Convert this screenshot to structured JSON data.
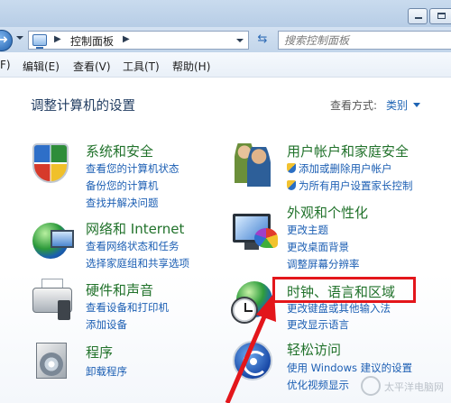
{
  "address_bar": {
    "crumb": "控制面板",
    "search_placeholder": "搜索控制面板"
  },
  "menu": {
    "items": [
      "F)",
      "编辑(E)",
      "查看(V)",
      "工具(T)",
      "帮助(H)"
    ]
  },
  "page": {
    "title": "调整计算机的设置",
    "view_by_label": "查看方式:",
    "view_by_value": "类别"
  },
  "categories": {
    "system_security": {
      "title": "系统和安全",
      "links": [
        "查看您的计算机状态",
        "备份您的计算机",
        "查找并解决问题"
      ]
    },
    "network_internet": {
      "title": "网络和 Internet",
      "links": [
        "查看网络状态和任务",
        "选择家庭组和共享选项"
      ]
    },
    "hardware_sound": {
      "title": "硬件和声音",
      "links": [
        "查看设备和打印机",
        "添加设备"
      ]
    },
    "programs": {
      "title": "程序",
      "links": [
        "卸载程序"
      ]
    },
    "user_accounts": {
      "title": "用户帐户和家庭安全",
      "links": [
        "添加或删除用户帐户",
        "为所有用户设置家长控制"
      ]
    },
    "appearance": {
      "title": "外观和个性化",
      "links": [
        "更改主题",
        "更改桌面背景",
        "调整屏幕分辨率"
      ]
    },
    "clock_region": {
      "title": "时钟、语言和区域",
      "links": [
        "更改键盘或其他输入法",
        "更改显示语言"
      ]
    },
    "ease_of_access": {
      "title": "轻松访问",
      "links": [
        "使用 Windows 建议的设置",
        "优化视频显示"
      ]
    }
  },
  "watermark": {
    "text": "太平洋电脑网"
  },
  "colors": {
    "category_title": "#21722b",
    "link": "#1b5eb3",
    "highlight": "#e3161b"
  }
}
